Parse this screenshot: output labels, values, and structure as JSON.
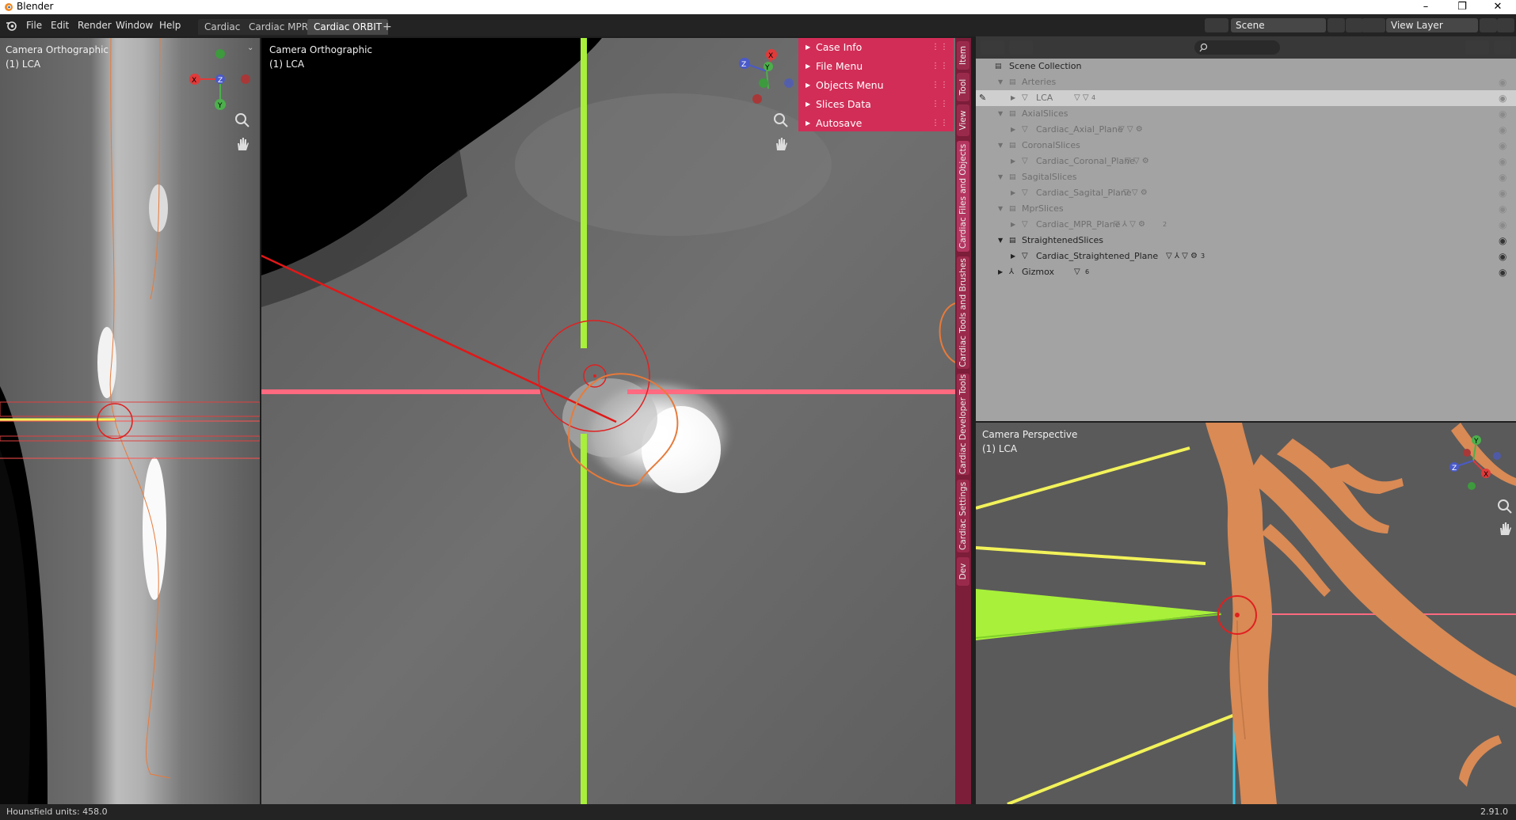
{
  "window": {
    "title": "Blender",
    "controls": [
      "–",
      "❐",
      "✕"
    ]
  },
  "menubar": {
    "items": [
      "File",
      "Edit",
      "Render",
      "Window",
      "Help"
    ]
  },
  "workspaces": {
    "tabs": [
      "Cardiac",
      "Cardiac MPR",
      "Cardiac ORBIT"
    ],
    "active": "Cardiac ORBIT",
    "add_label": "+"
  },
  "scene": {
    "name": "Scene",
    "view_layer": "View Layer"
  },
  "viewports": {
    "left": {
      "view": "Camera Orthographic",
      "object": "(1) LCA",
      "axes": [
        "X",
        "Z",
        "Y"
      ]
    },
    "center": {
      "view": "Camera Orthographic",
      "object": "(1) LCA",
      "axes": [
        "X",
        "Z",
        "Y"
      ]
    },
    "right": {
      "view": "Camera Perspective",
      "object": "(1) LCA",
      "axes": [
        "Y",
        "Z",
        "X"
      ]
    }
  },
  "npanel": {
    "items": [
      "Case Info",
      "File Menu",
      "Objects Menu",
      "Slices Data",
      "Autosave"
    ]
  },
  "sidetabs": [
    "Item",
    "Tool",
    "View",
    "Cardiac Files and Objects",
    "Cardiac Tools and Brushes",
    "Cardiac Developer Tools",
    "Cardiac Settings",
    "Dev"
  ],
  "outliner": {
    "root": "Scene Collection",
    "rows": [
      {
        "label": "Arteries",
        "dim": true
      },
      {
        "label": "LCA",
        "dim": true,
        "highlight": true,
        "badge": "4"
      },
      {
        "label": "AxialSlices",
        "dim": true
      },
      {
        "label": "Cardiac_Axial_Plane",
        "dim": true
      },
      {
        "label": "CoronalSlices",
        "dim": true
      },
      {
        "label": "Cardiac_Coronal_Plane",
        "dim": true
      },
      {
        "label": "SagitalSlices",
        "dim": true
      },
      {
        "label": "Cardiac_Sagital_Plane",
        "dim": true
      },
      {
        "label": "MprSlices",
        "dim": true
      },
      {
        "label": "Cardiac_MPR_Plane",
        "dim": true,
        "badge": "2"
      },
      {
        "label": "StraightenedSlices",
        "dim": false
      },
      {
        "label": "Cardiac_Straightened_Plane",
        "dim": false,
        "badge": "3"
      },
      {
        "label": "Gizmox",
        "dim": false,
        "badge": "6"
      }
    ]
  },
  "statusbar": {
    "left": "Hounsfield units: 458.0",
    "right": "2.91.0"
  },
  "colors": {
    "accent_panel": "#d22d57",
    "sidetab_bg": "#7c1d3a",
    "green_line": "#a8f03a",
    "pink_line": "#ff6a80",
    "red_ring": "#e02020",
    "orange_contour": "#e87a3a",
    "cyan_line": "#3cc8e8",
    "yellow_line": "#f2f25a",
    "vessel": "#d98a55"
  }
}
